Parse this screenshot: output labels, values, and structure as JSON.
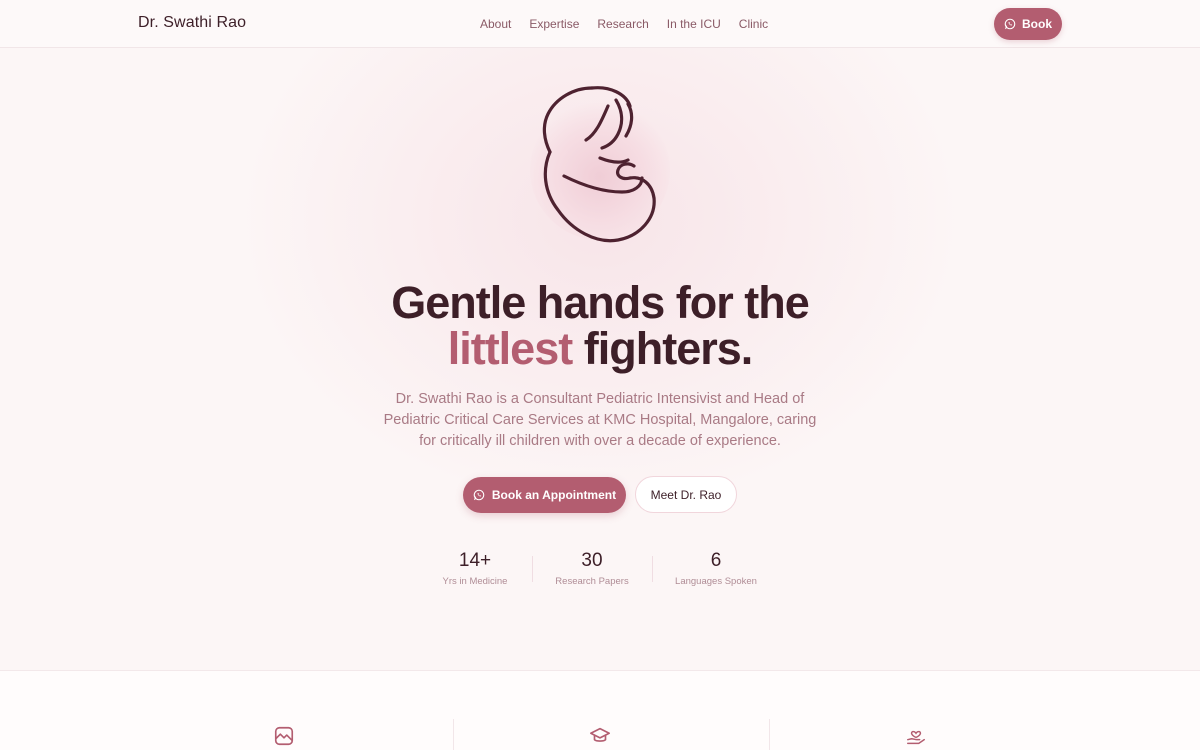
{
  "nav": {
    "brand": "Dr. Swathi Rao",
    "links": [
      "About",
      "Expertise",
      "Research",
      "In the ICU",
      "Clinic"
    ],
    "book_label": "Book"
  },
  "hero": {
    "headline_line1": "Gentle hands for the",
    "headline_accent": "littlest",
    "headline_rest": "fighters.",
    "description": "Dr. Swathi Rao is a Consultant Pediatric Intensivist and Head of Pediatric Critical Care Services at KMC Hospital, Mangalore, caring for critically ill children with over a decade of experience.",
    "primary_button": "Book an Appointment",
    "secondary_button": "Meet Dr. Rao"
  },
  "stats": [
    {
      "value": "14+",
      "label": "Yrs in Medicine"
    },
    {
      "value": "30",
      "label": "Research Papers"
    },
    {
      "value": "6",
      "label": "Languages Spoken"
    }
  ],
  "features": {
    "icons": [
      "image-icon",
      "graduation-cap-icon",
      "heart-hand-icon"
    ]
  },
  "colors": {
    "accent": "#b35d70",
    "text_dark": "#3d1f28",
    "text_muted": "#a97a85",
    "background": "#fdf8f8"
  }
}
